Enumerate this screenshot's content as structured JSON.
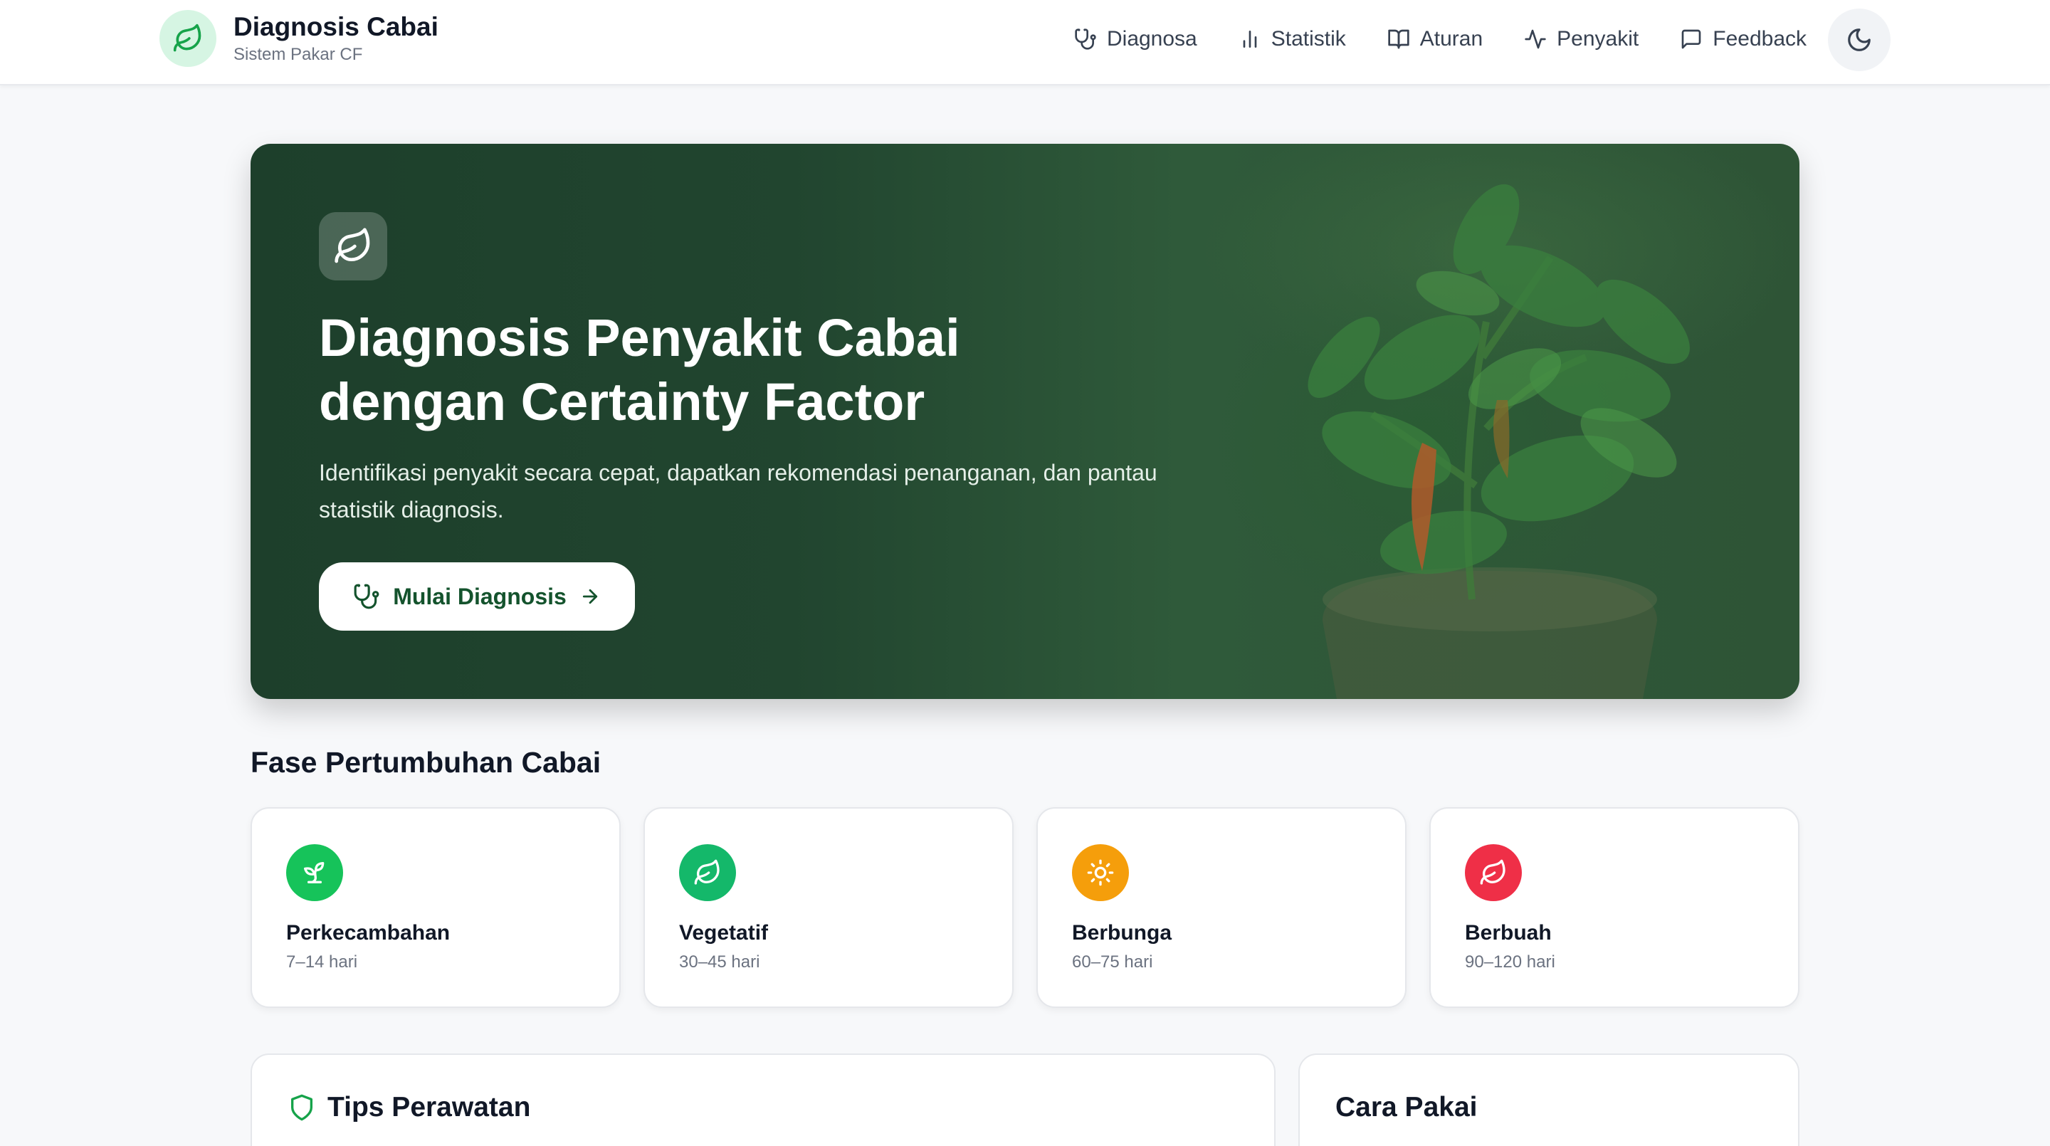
{
  "header": {
    "brand_title": "Diagnosis Cabai",
    "brand_subtitle": "Sistem Pakar CF",
    "nav": [
      {
        "label": "Diagnosa",
        "icon": "stethoscope-icon"
      },
      {
        "label": "Statistik",
        "icon": "bar-chart-icon"
      },
      {
        "label": "Aturan",
        "icon": "book-icon"
      },
      {
        "label": "Penyakit",
        "icon": "activity-icon"
      },
      {
        "label": "Feedback",
        "icon": "message-icon"
      }
    ],
    "theme_icon": "moon-icon"
  },
  "hero": {
    "icon": "leaf-icon",
    "title_line1": "Diagnosis Penyakit Cabai",
    "title_line2": "dengan Certainty Factor",
    "description": "Identifikasi penyakit secara cepat, dapatkan rekomendasi penanganan, dan pantau statistik diagnosis.",
    "cta_label": "Mulai Diagnosis"
  },
  "phases": {
    "title": "Fase Pertumbuhan Cabai",
    "items": [
      {
        "name": "Perkecambahan",
        "days": "7–14 hari",
        "icon": "sprout-icon",
        "color": "#16c35a"
      },
      {
        "name": "Vegetatif",
        "days": "30–45 hari",
        "icon": "leaf-icon",
        "color": "#14b86a"
      },
      {
        "name": "Berbunga",
        "days": "60–75 hari",
        "icon": "sun-icon",
        "color": "#f59e0b"
      },
      {
        "name": "Berbuah",
        "days": "90–120 hari",
        "icon": "leaf-icon",
        "color": "#ef2f47"
      }
    ]
  },
  "panels": {
    "tips_title": "Tips Perawatan",
    "usage_title": "Cara Pakai"
  },
  "colors": {
    "accent": "#16a34a",
    "hero_bg": "#21452f",
    "page_bg": "#f7f8fa"
  }
}
